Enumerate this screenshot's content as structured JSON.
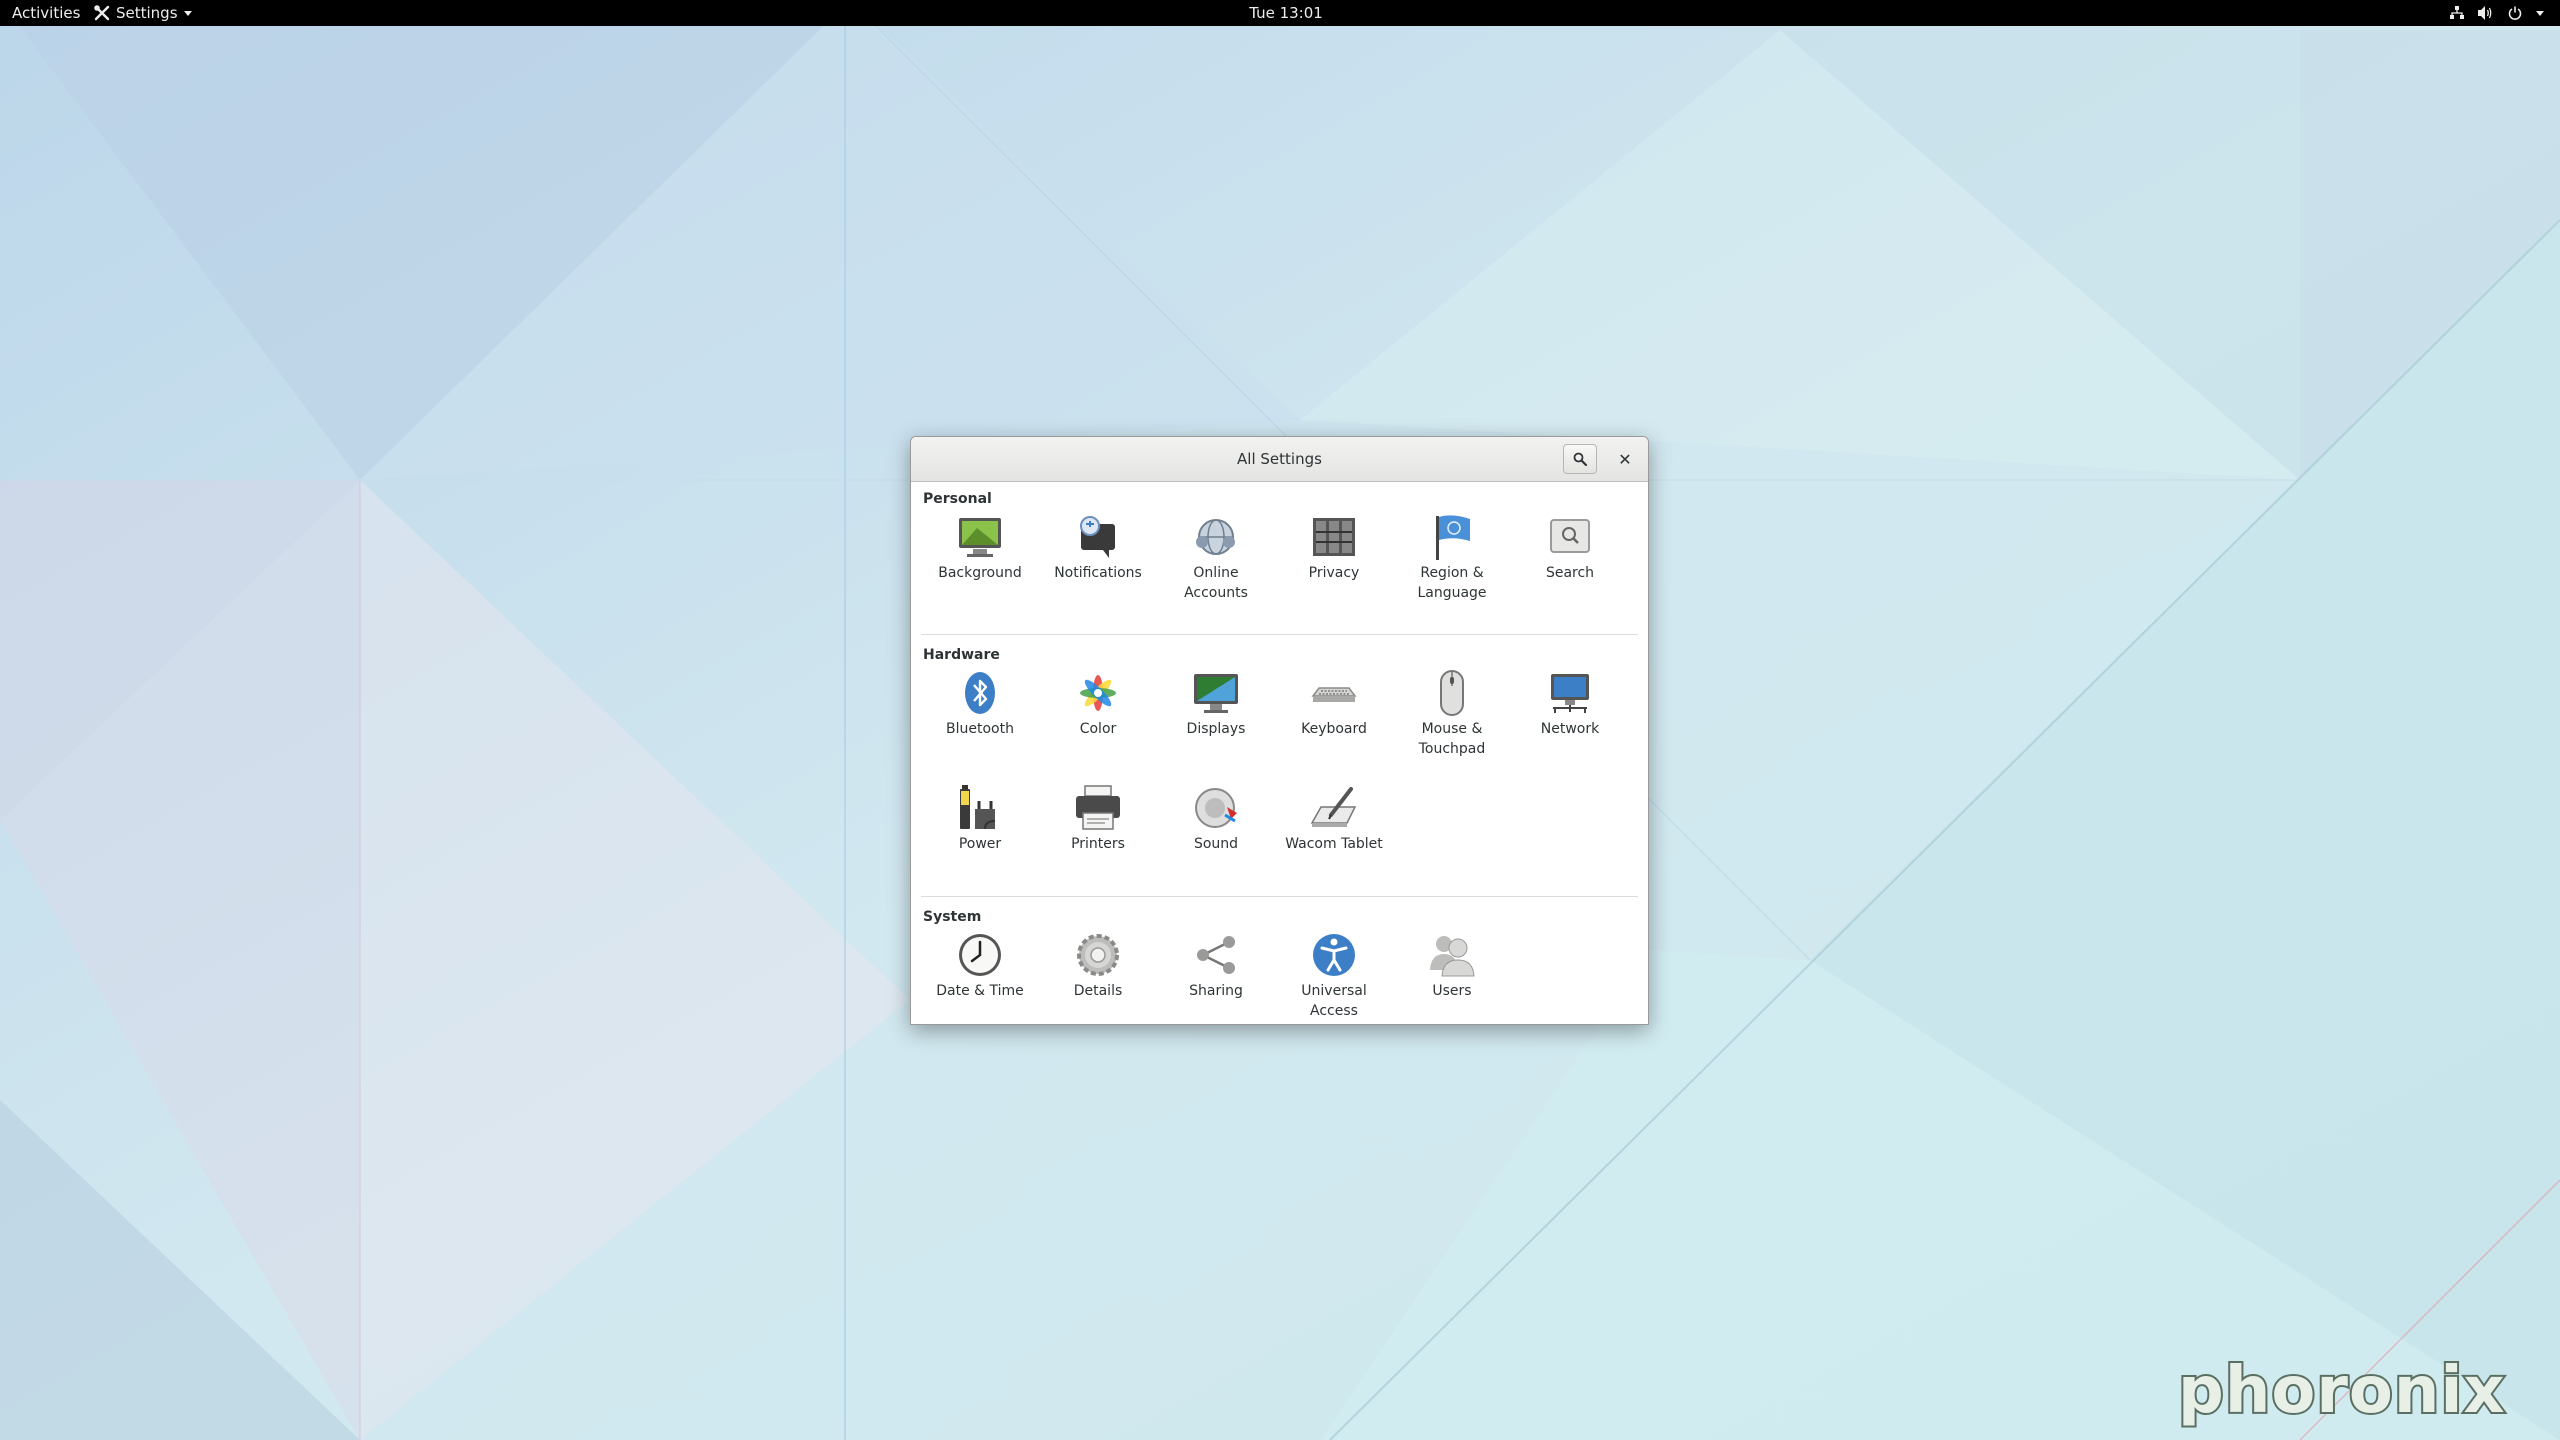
{
  "topbar": {
    "activities": "Activities",
    "app_menu": "Settings",
    "clock": "Tue 13:01",
    "icons": [
      "network-icon",
      "volume-icon",
      "power-icon",
      "chevron-down-icon"
    ]
  },
  "window": {
    "title": "All Settings",
    "search_icon": "search-icon",
    "close_label": "✕"
  },
  "sections": {
    "personal": {
      "title": "Personal",
      "items": [
        "Background",
        "Notifications",
        "Online Accounts",
        "Privacy",
        "Region & Language",
        "Search"
      ]
    },
    "hardware": {
      "title": "Hardware",
      "items": [
        "Bluetooth",
        "Color",
        "Displays",
        "Keyboard",
        "Mouse & Touchpad",
        "Network",
        "Power",
        "Printers",
        "Sound",
        "Wacom Tablet"
      ]
    },
    "system": {
      "title": "System",
      "items": [
        "Date & Time",
        "Details",
        "Sharing",
        "Universal Access",
        "Users"
      ]
    }
  },
  "watermark": {
    "text": "phoronix"
  },
  "colors": {
    "topbar": "#000000",
    "wallpaper_base": "#cfe6ee",
    "accent_blue": "#3d7fc6"
  }
}
